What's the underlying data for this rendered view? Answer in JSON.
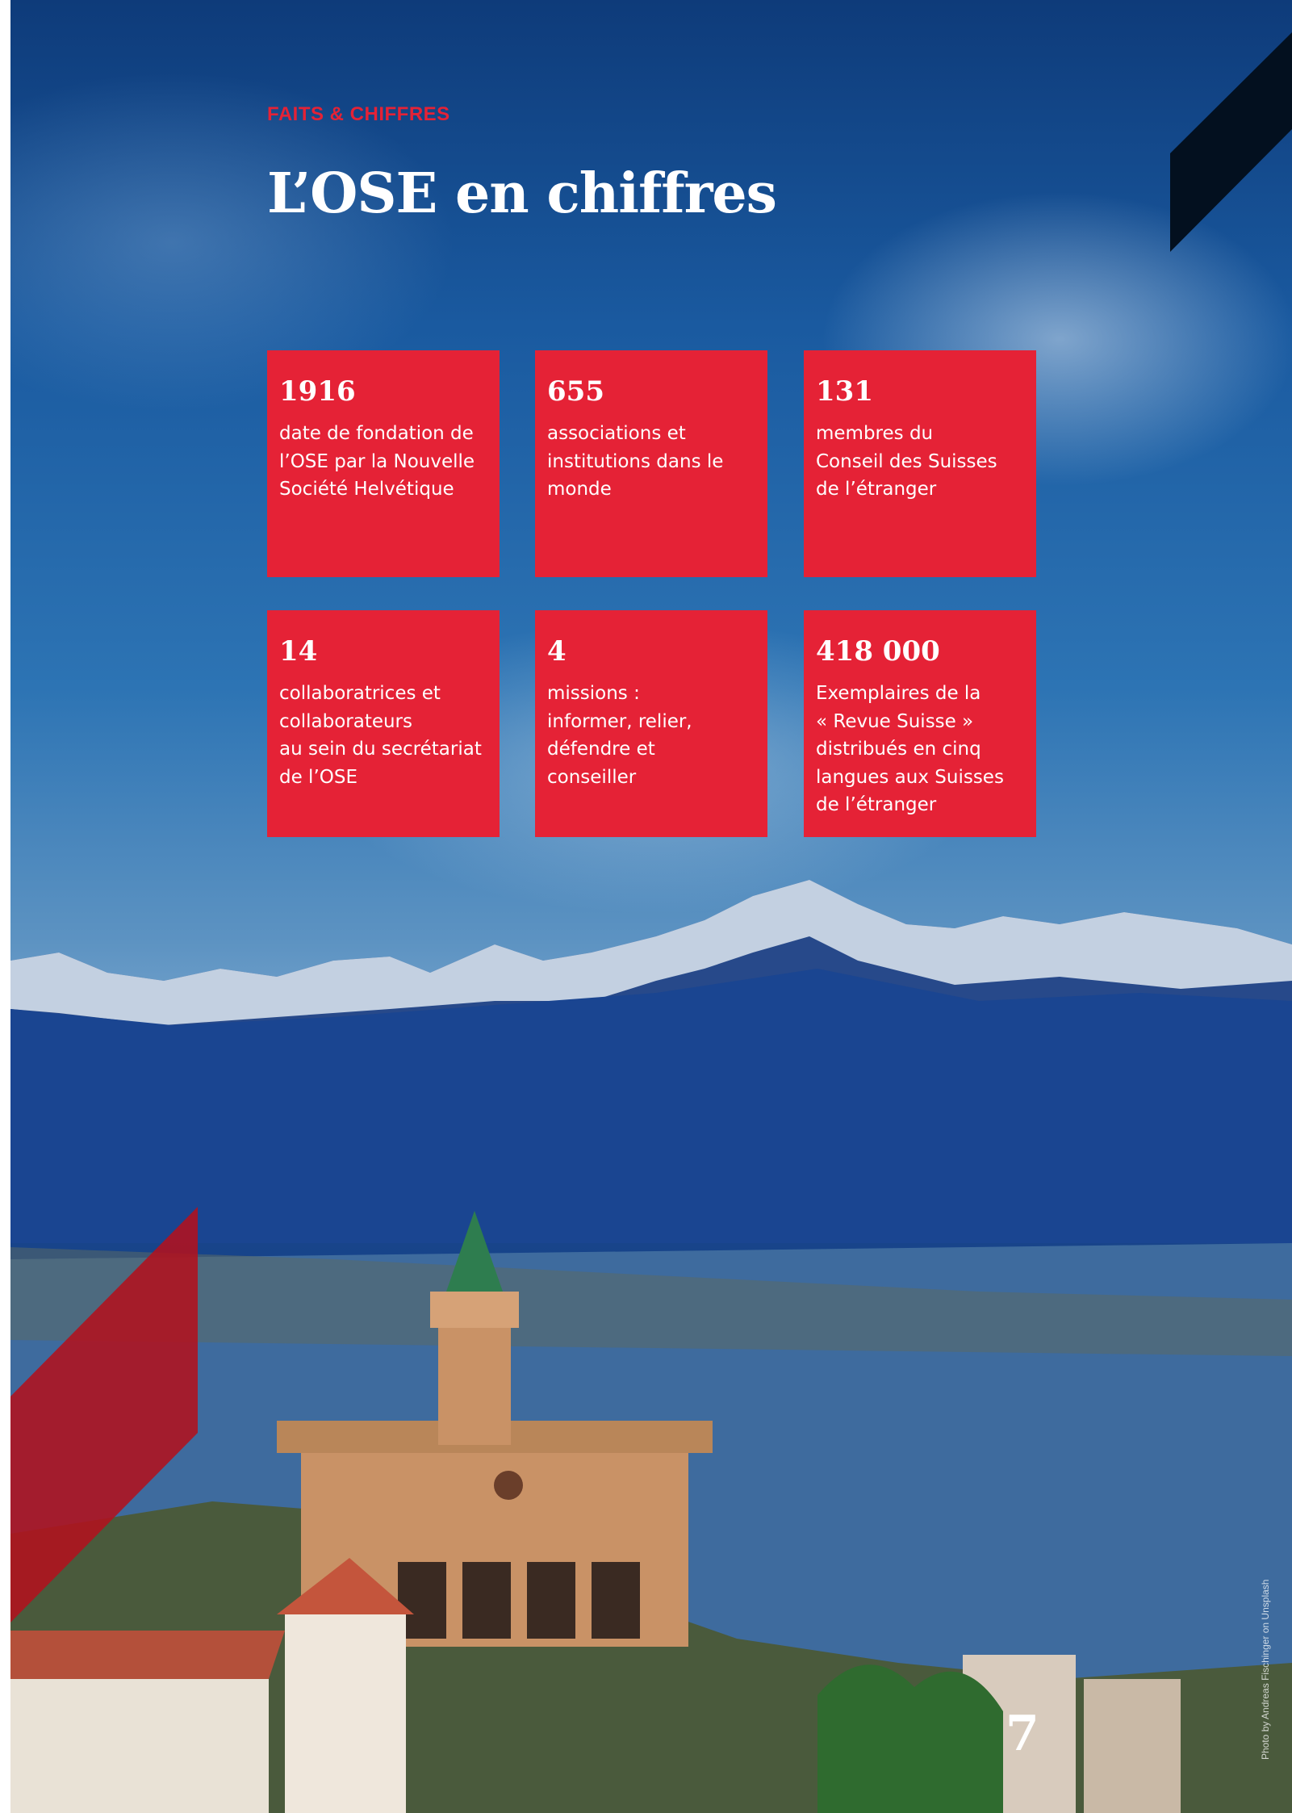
{
  "section_kicker": "FAITS & CHIFFRES",
  "title": "L’OSE en chiffres",
  "facts": [
    {
      "number": "1916",
      "description": "date de fondation de\nl’OSE par la Nouvelle\nSociété Helvétique"
    },
    {
      "number": "655",
      "description": "associations et\ninstitutions dans le\nmonde"
    },
    {
      "number": "131",
      "description": "membres du\nConseil des Suisses\nde l’étranger"
    },
    {
      "number": "14",
      "description": "collaboratrices et\ncollaborateurs\nau sein du secrétariat\nde l’OSE"
    },
    {
      "number": "4",
      "description": "missions :\ninformer, relier,\ndéfendre et\nconseiller"
    },
    {
      "number": "418 000",
      "description": "Exemplaires de la\n« Revue Suisse »\ndistribués en cinq\nlangues aux Suisses\nde l’étranger"
    }
  ],
  "page_number": "7",
  "photo_credit": "Photo by Andreas Fischinger on Unsplash",
  "colors": {
    "accent_red": "#e52236",
    "sky_blue": "#2d74b4",
    "dark_navy": "#03101f"
  }
}
